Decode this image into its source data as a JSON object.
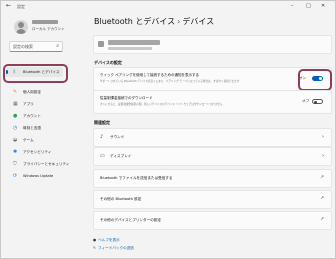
{
  "window": {
    "back_glyph": "←",
    "app_title": "設定",
    "minimize": "–",
    "maximize": "□",
    "close": "✕"
  },
  "user": {
    "account_label": "ローカル アカウント"
  },
  "search": {
    "placeholder": "設定の検索",
    "icon": "search-icon"
  },
  "sidebar": {
    "items": [
      {
        "label": "Bluetooth とデバイス",
        "icon": "bluetooth-icon",
        "color": "#0067c0",
        "active": true
      },
      {
        "label": "個人用設定",
        "icon": "brush-icon",
        "color": "#e3892c"
      },
      {
        "label": "アプリ",
        "icon": "apps-icon",
        "color": "#5a6b7b"
      },
      {
        "label": "アカウント",
        "icon": "account-icon",
        "color": "#2f9e6b"
      },
      {
        "label": "時刻と言語",
        "icon": "clock-globe-icon",
        "color": "#1f7fd6"
      },
      {
        "label": "ゲーム",
        "icon": "gamepad-icon",
        "color": "#6b6b6b"
      },
      {
        "label": "アクセシビリティ",
        "icon": "accessibility-icon",
        "color": "#1f7fd6"
      },
      {
        "label": "プライバシーとセキュリティ",
        "icon": "shield-icon",
        "color": "#6b6b6b"
      },
      {
        "label": "Windows Update",
        "icon": "windows-update-icon",
        "color": "#1f7fd6"
      }
    ]
  },
  "header": {
    "parent": "Bluetooth とデバイス",
    "separator": "›",
    "current": "デバイス"
  },
  "sections": {
    "device_settings": "デバイスの設定",
    "related_settings": "関連設定"
  },
  "settings": {
    "swift_pair": {
      "title": "クイック ペアリングを使用して接続するための通知を表示する",
      "description": "サポートされている Bluetooth デバイスが近くにあり、ペアリング モードになっている場合は、すばやく接続できます",
      "state": "オン",
      "on": true
    },
    "metered": {
      "title": "従量制課金接続でのダウンロード",
      "description": "オンにすると、従量制課金接続の間、新しいデバイスのデバイス ソフトウェアはダウンロードされません",
      "state": "オフ",
      "on": false
    }
  },
  "related": [
    {
      "label": "サウンド",
      "icon": "speaker-icon",
      "action": "chevron"
    },
    {
      "label": "ディスプレイ",
      "icon": "monitor-icon",
      "action": "chevron"
    },
    {
      "label": "Bluetooth でファイルを送信または受信する",
      "action": "external"
    },
    {
      "label": "その他の Bluetooth 設定",
      "action": "external"
    },
    {
      "label": "その他のデバイスとプリンターの設定",
      "action": "external"
    }
  ],
  "footer": {
    "help": "ヘルプを表示",
    "feedback": "フィードバックの送信"
  },
  "colors": {
    "accent": "#005fb8",
    "highlight": "#8e3e5c"
  }
}
